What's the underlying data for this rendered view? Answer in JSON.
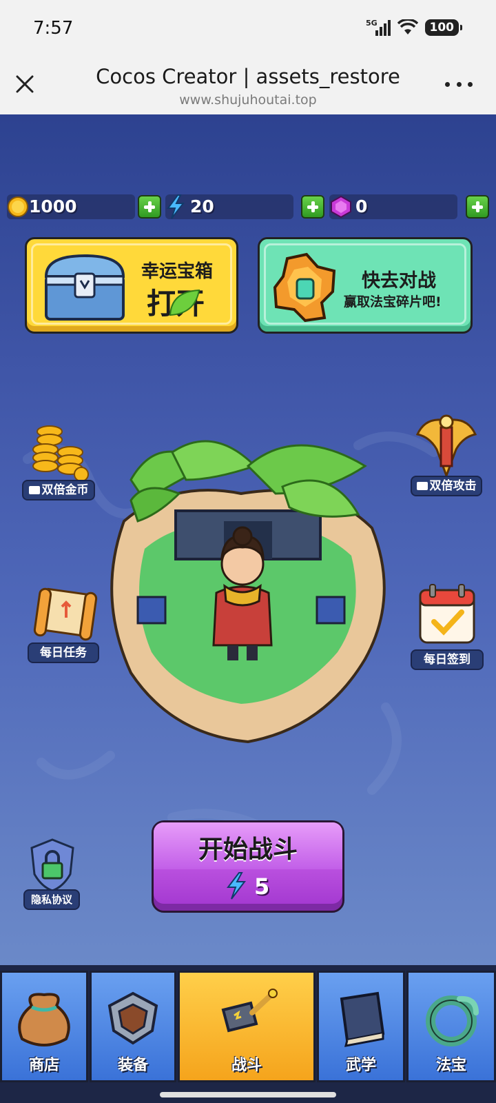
{
  "status_bar": {
    "time": "7:57",
    "network": "5G",
    "battery": "100"
  },
  "browser": {
    "title": "Cocos Creator | assets_restore",
    "url": "www.shujuhoutai.top"
  },
  "resources": {
    "gold": "1000",
    "energy": "20",
    "gems": "0"
  },
  "banners": {
    "lucky_chest": {
      "line1": "幸运宝箱",
      "line2": "打开"
    },
    "battle_promo": {
      "line1": "快去对战",
      "line2": "赢取法宝碎片吧!"
    }
  },
  "side_buttons": {
    "double_gold": "双倍金币",
    "double_attack": "双倍攻击",
    "daily_task": "每日任务",
    "daily_checkin": "每日签到",
    "privacy": "隐私协议"
  },
  "start_battle": {
    "label": "开始战斗",
    "cost": "5"
  },
  "nav": {
    "tabs": [
      {
        "label": "商店",
        "active": false
      },
      {
        "label": "装备",
        "active": false
      },
      {
        "label": "战斗",
        "active": true
      },
      {
        "label": "武学",
        "active": false
      },
      {
        "label": "法宝",
        "active": false
      }
    ]
  },
  "colors": {
    "accent_purple": "#c25fe8",
    "nav_active": "#f5a41c",
    "nav_blue": "#3a72d8",
    "banner_yellow": "#ffd93a",
    "banner_green": "#6ee3b5"
  }
}
